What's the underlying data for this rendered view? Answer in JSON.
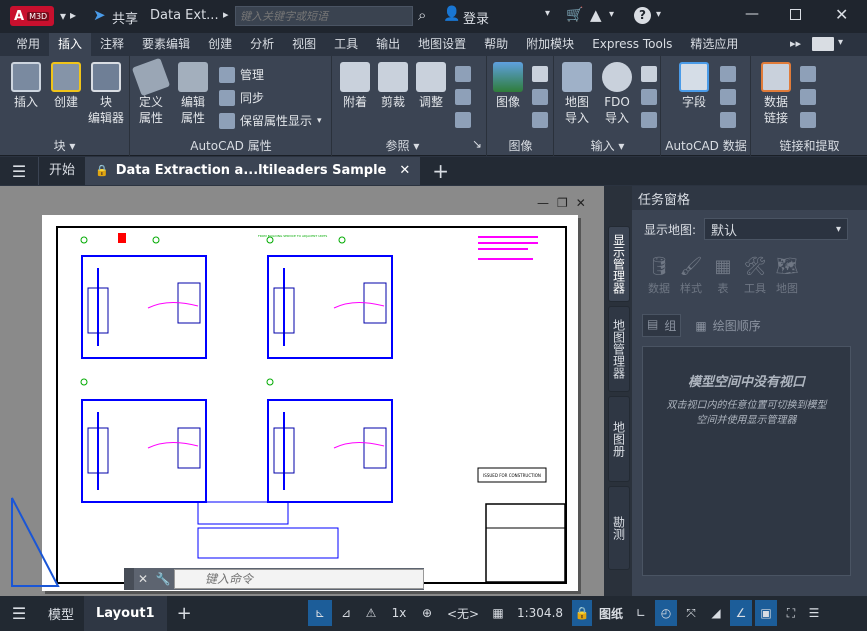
{
  "titlebar": {
    "app_badge": "A",
    "app_sub": "M3D",
    "share_label": "共享",
    "doc_title": "Data Ext...",
    "search_placeholder": "键入关键字或短语",
    "login_label": "登录",
    "help_symbol": "?"
  },
  "ribbon_tabs": [
    "常用",
    "插入",
    "注释",
    "要素编辑",
    "创建",
    "分析",
    "视图",
    "工具",
    "输出",
    "地图设置",
    "帮助",
    "附加模块",
    "Express Tools",
    "精选应用"
  ],
  "ribbon_active_tab": "插入",
  "ribbon": {
    "block_group": {
      "label": "块",
      "insert": "插入",
      "create": "创建",
      "block_editor_1": "块",
      "block_editor_2": "编辑器"
    },
    "attr_group": {
      "label": "AutoCAD 属性",
      "define_1": "定义",
      "define_2": "属性",
      "edit_1": "编辑",
      "edit_2": "属性",
      "manage": "管理",
      "sync": "同步",
      "keep_display": "保留属性显示"
    },
    "ref_group": {
      "label": "参照",
      "attach": "附着",
      "clip": "剪裁",
      "adjust": "调整"
    },
    "image_group": {
      "label": "图像",
      "image": "图像"
    },
    "import_group": {
      "label": "输入",
      "map_import_1": "地图",
      "map_import_2": "导入",
      "fdo_import_1": "FDO",
      "fdo_import_2": "导入"
    },
    "data_group": {
      "label": "AutoCAD 数据",
      "field": "字段"
    },
    "link_group": {
      "label": "链接和提取",
      "data_link_1": "数据",
      "data_link_2": "链接"
    }
  },
  "doc_tabs": {
    "start": "开始",
    "active": "Data Extraction a...ltileaders Sample",
    "add": "+"
  },
  "drawing": {
    "title_note": "FROM BUILDING SERVICE TO ADJACENT UNITS",
    "block_label": "ISSUED FOR CONSTRUCTION",
    "command_placeholder": "键入命令"
  },
  "taskpane": {
    "title": "任务窗格",
    "display_map_label": "显示地图:",
    "display_map_value": "默认",
    "tools": [
      "数据",
      "样式",
      "表",
      "工具",
      "地图"
    ],
    "group_label": "组",
    "order_label": "绘图顺序",
    "empty_title": "模型空间中没有视口",
    "empty_desc": "双击视口内的任意位置可切换到模型空间并使用显示管理器",
    "vtabs": [
      "显示管理器",
      "地图管理器",
      "地图册",
      "勘测"
    ]
  },
  "statusbar": {
    "model_tab": "模型",
    "layout_tab": "Layout1",
    "scale_1x": "1x",
    "none_label": "<无>",
    "scale": "1:304.8",
    "paper": "图纸"
  },
  "colors": {
    "accent": "#1c7ad6",
    "brand": "#d7263d",
    "ribbon_bg": "#3b4453"
  }
}
